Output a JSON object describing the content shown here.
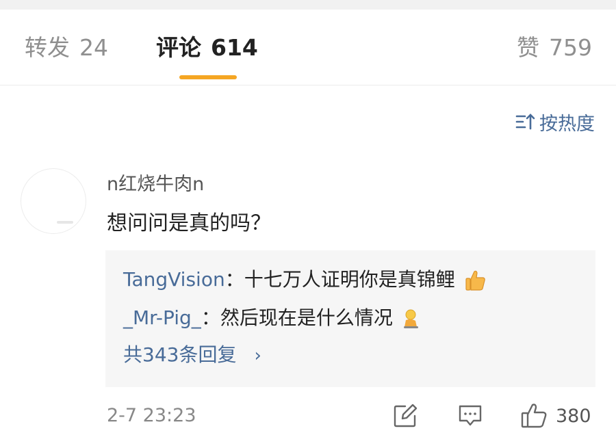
{
  "tabs": [
    {
      "label": "转发",
      "count": "24"
    },
    {
      "label": "评论",
      "count": "614"
    },
    {
      "label": "赞",
      "count": "759"
    }
  ],
  "sort": {
    "label": "按热度",
    "icon": "sort-icon"
  },
  "comment": {
    "username": "n红烧牛肉n",
    "text": "想问问是真的吗？",
    "replies": [
      {
        "author": "TangVision",
        "separator": "：",
        "text": "十七万人证明你是真锦鲤",
        "emoji": "thumbs-up-emoji"
      },
      {
        "author": "_Mr-Pig_",
        "separator": "：",
        "text": "然后现在是什么情况",
        "emoji": "kneeling-emoji"
      }
    ],
    "more_replies": "共343条回复",
    "more_chevron": "›",
    "time": "2-7 23:23",
    "like_count": "380"
  },
  "colors": {
    "accent": "#f5a623",
    "link": "#486b98",
    "reply_bg": "#f6f6f6"
  }
}
